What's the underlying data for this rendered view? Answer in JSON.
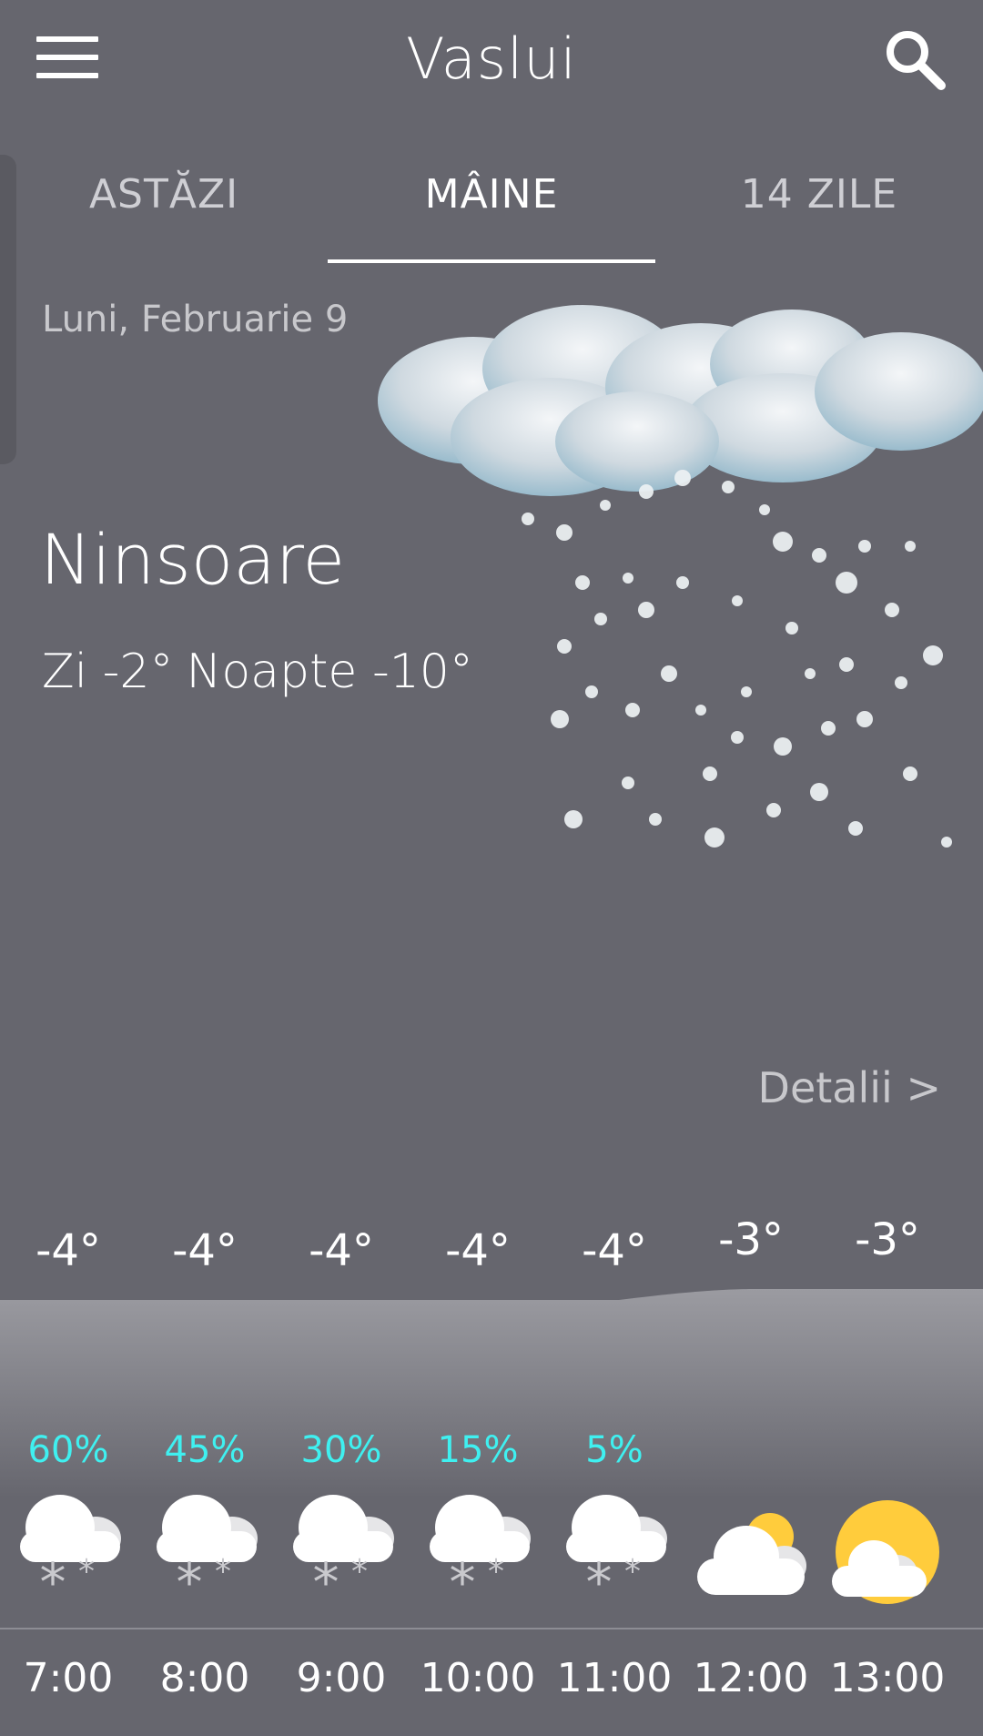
{
  "header": {
    "city": "Vaslui",
    "menu_icon": "hamburger-menu-icon",
    "search_icon": "search-icon"
  },
  "tabs": [
    {
      "label": "ASTĂZI",
      "active": false
    },
    {
      "label": "MÂINE",
      "active": true
    },
    {
      "label": "14 ZILE",
      "active": false
    }
  ],
  "forecast": {
    "date": "Luni, Februarie 9",
    "condition": "Ninsoare",
    "day_label": "Zi -2°",
    "night_label": "Noapte -10°",
    "illustration": "snow-cloud-icon",
    "details_label": "Detalii >"
  },
  "hourly": [
    {
      "time": "7:00",
      "temp": "-4°",
      "precip": "60%",
      "icon": "snow-cloud-icon"
    },
    {
      "time": "8:00",
      "temp": "-4°",
      "precip": "45%",
      "icon": "snow-cloud-icon"
    },
    {
      "time": "9:00",
      "temp": "-4°",
      "precip": "30%",
      "icon": "snow-cloud-icon"
    },
    {
      "time": "10:00",
      "temp": "-4°",
      "precip": "15%",
      "icon": "snow-cloud-icon"
    },
    {
      "time": "11:00",
      "temp": "-4°",
      "precip": "5%",
      "icon": "snow-cloud-icon"
    },
    {
      "time": "12:00",
      "temp": "-3°",
      "precip": "",
      "icon": "partly-cloudy-icon"
    },
    {
      "time": "13:00",
      "temp": "-3°",
      "precip": "",
      "icon": "sun-cloud-icon"
    }
  ],
  "colors": {
    "background": "#66666e",
    "precip": "#3ff0f0",
    "sun": "#ffcc3c"
  }
}
